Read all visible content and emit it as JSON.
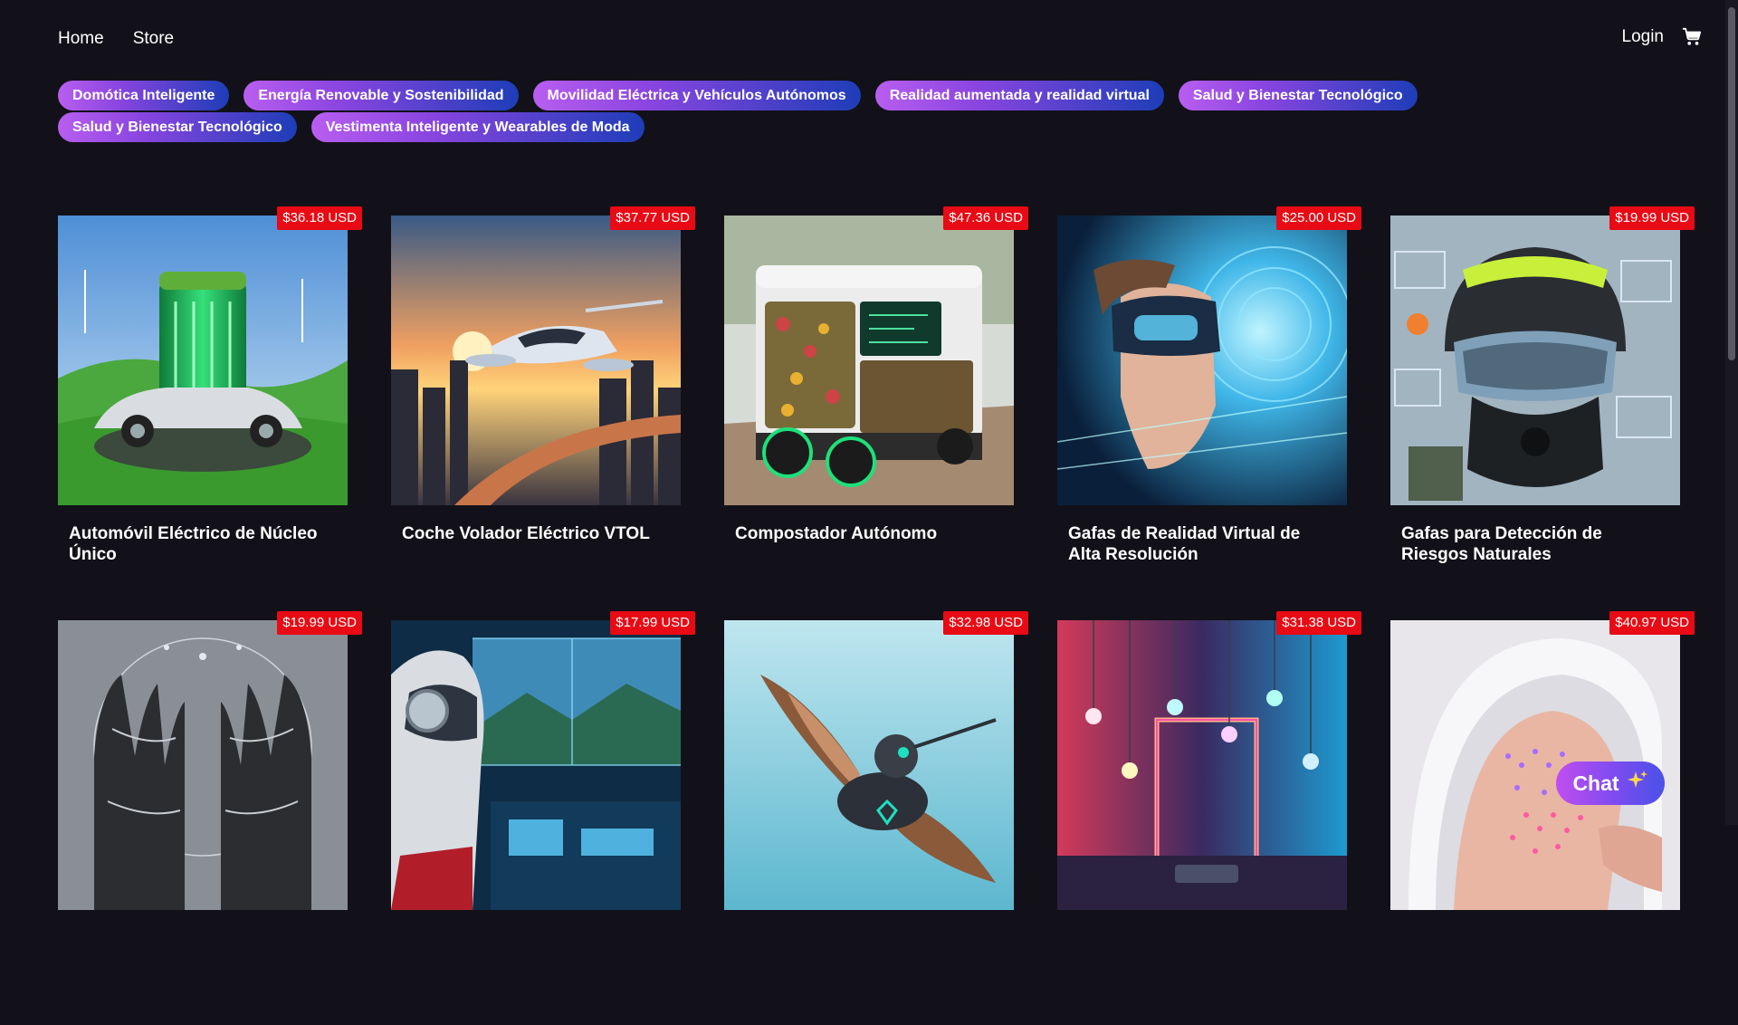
{
  "nav": {
    "home_label": "Home",
    "store_label": "Store",
    "login_label": "Login",
    "cart_icon": "cart-icon"
  },
  "categories": [
    "Domótica Inteligente",
    "Energía Renovable y Sostenibilidad",
    "Movilidad Eléctrica y Vehículos Autónomos",
    "Realidad aumentada y realidad virtual",
    "Salud y Bienestar Tecnológico",
    "Salud y Bienestar Tecnológico",
    "Vestimenta Inteligente y Wearables de Moda"
  ],
  "products": [
    {
      "title": "Automóvil Eléctrico de Núcleo Único",
      "price": "$36.18 USD"
    },
    {
      "title": "Coche Volador Eléctrico VTOL",
      "price": "$37.77 USD"
    },
    {
      "title": "Compostador Autónomo",
      "price": "$47.36 USD"
    },
    {
      "title": "Gafas de Realidad Virtual de Alta Resolución",
      "price": "$25.00 USD"
    },
    {
      "title": "Gafas para Detección de Riesgos Naturales",
      "price": "$19.99 USD"
    },
    {
      "title": "",
      "price": "$19.99 USD"
    },
    {
      "title": "",
      "price": "$17.99 USD"
    },
    {
      "title": "",
      "price": "$32.98 USD"
    },
    {
      "title": "",
      "price": "$31.38 USD"
    },
    {
      "title": "",
      "price": "$40.97 USD"
    }
  ],
  "chat": {
    "label": "Chat",
    "icon": "sparkles-icon"
  },
  "colors": {
    "background": "#121119",
    "price_badge": "#e80a14",
    "chip_start": "#b85ef0",
    "chip_end": "#1e3db8"
  }
}
